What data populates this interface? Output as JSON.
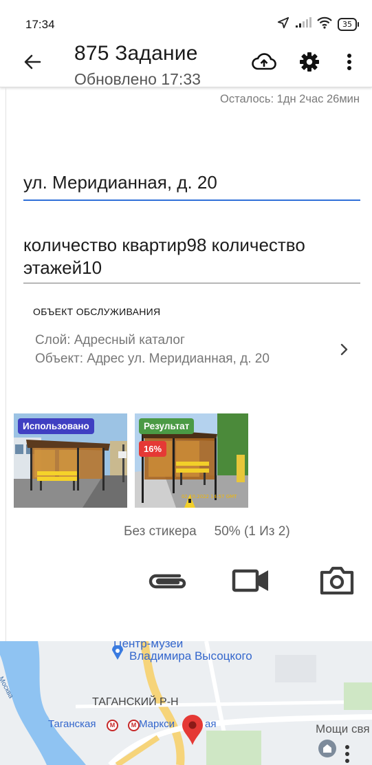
{
  "status_bar": {
    "time": "17:34",
    "battery": "35",
    "icons": [
      "location-arrow-icon",
      "signal-icon",
      "wifi-icon",
      "battery-icon"
    ]
  },
  "app_bar": {
    "title": "875 Задание",
    "subtitle": "Обновлено 17:33",
    "icons": [
      "back-arrow-icon",
      "cloud-upload-icon",
      "gear-icon",
      "more-vert-icon"
    ]
  },
  "remaining": "Осталось: 1дн 2час 26мин",
  "fields": {
    "address": "ул. Меридианная, д. 20",
    "description": "количество квартир98 количество этажей10"
  },
  "service_object": {
    "label": "ОБЪЕКТ ОБСЛУЖИВАНИЯ",
    "layer": "Слой: Адресный каталог",
    "object": "Объект: Адрес  ул. Меридианная, д. 20"
  },
  "photos": [
    {
      "badge": "Использовано"
    },
    {
      "badge": "Результат",
      "percent": "16%",
      "stamp": "02.10.2022 14:57 GMT"
    }
  ],
  "sticker": {
    "status": "Без стикера",
    "progress": "50% (1 Из 2)"
  },
  "actions": [
    "paperclip-icon",
    "video-camera-icon",
    "photo-camera-icon"
  ],
  "map": {
    "labels": {
      "museum_line1": "Центр-музей",
      "museum_line2": "Владимира Высоцкого",
      "district": "ТАГАНСКИЙ Р-Н",
      "metro1": "Таганская",
      "metro2": "Маркси",
      "metro2_tail": "ая",
      "relics": "Мощи свя",
      "river": "р. Москва"
    },
    "colors": {
      "land": "#eceff2",
      "river": "#8fc3f2",
      "road_major": "#f6d47a",
      "park": "#cfe7c5",
      "pin": "#e53935",
      "label_blue": "#3366cc"
    }
  }
}
